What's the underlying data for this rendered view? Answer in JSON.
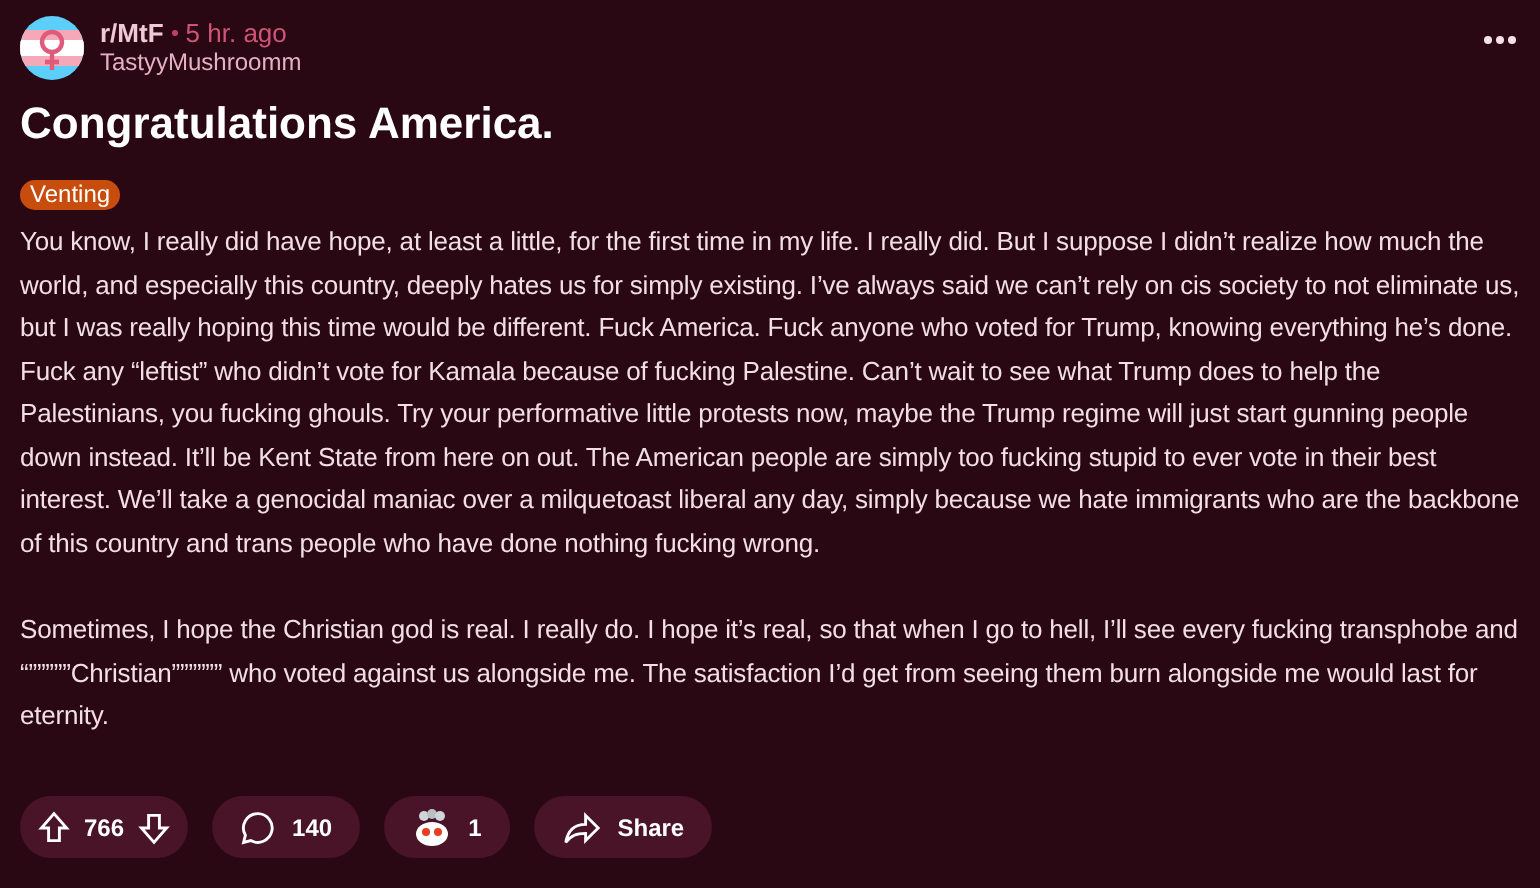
{
  "post": {
    "subreddit": "r/MtF",
    "time": "5 hr. ago",
    "author": "TastyyMushroomm",
    "title": "Congratulations America.",
    "flair": "Venting",
    "paragraphs": [
      "You know, I really did have hope, at least a little, for the first time in my life. I really did. But I suppose I didn’t realize how much the world, and especially this country, deeply hates us for simply existing. I’ve always said we can’t rely on cis society to not eliminate us, but I was really hoping this time would be different. Fuck America. Fuck anyone who voted for Trump, knowing everything he’s done. Fuck any “leftist” who didn’t vote for Kamala because of fucking Palestine. Can’t wait to see what Trump does to help the Palestinians, you fucking ghouls. Try your performative little protests now, maybe the Trump regime will just start gunning people down instead. It’ll be Kent State from here on out. The American people are simply too fucking stupid to ever vote in their best interest. We’ll take a genocidal maniac over a milquetoast liberal any day, simply because we hate immigrants who are the backbone of this country and trans people who have done nothing fucking wrong.",
      "Sometimes, I hope the Christian god is real. I really do. I hope it’s real, so that when I go to hell, I’ll see every fucking transphobe and “”””””Christian”””””” who voted against us alongside me. The satisfaction I’d get from seeing them burn alongside me would last for eternity."
    ]
  },
  "actions": {
    "votes": "766",
    "comments": "140",
    "awards": "1",
    "share": "Share"
  }
}
